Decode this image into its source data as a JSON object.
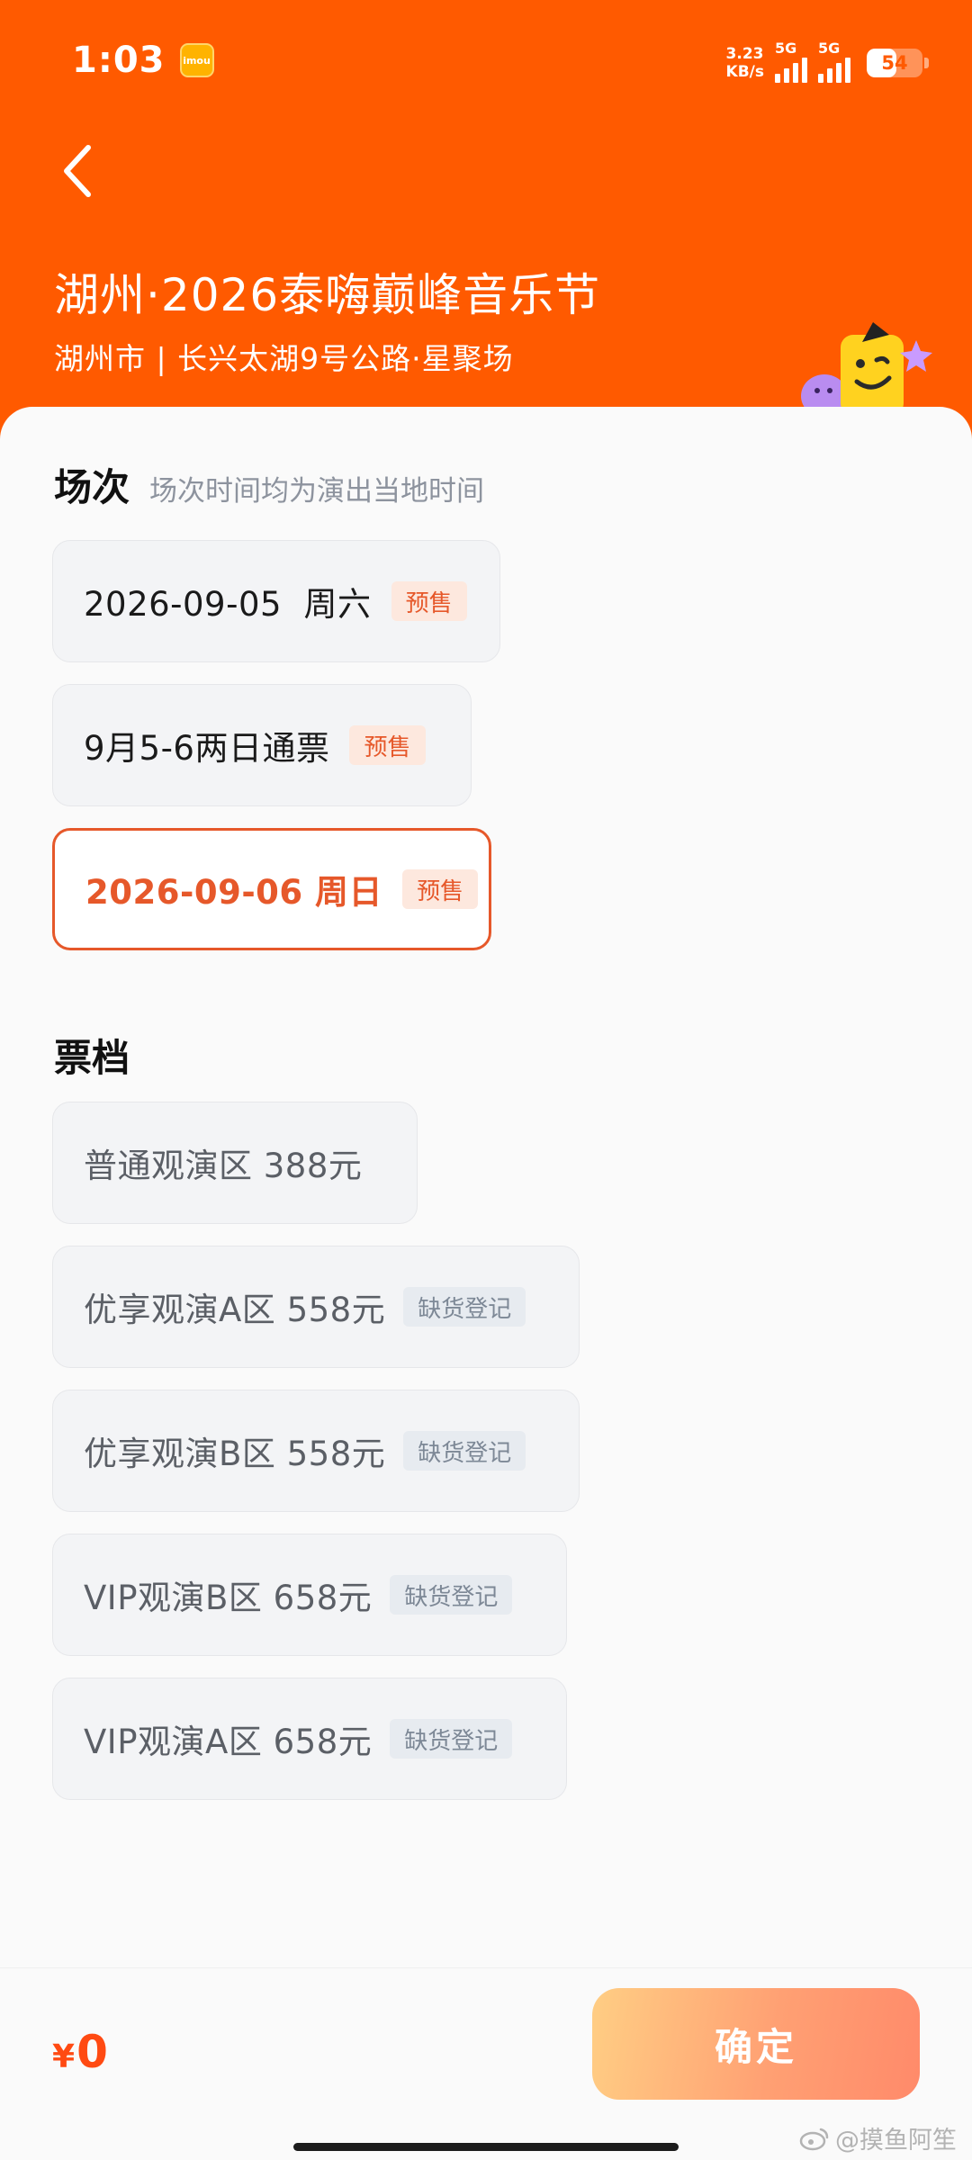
{
  "status_bar": {
    "time": "1:03",
    "app_badge": "imou",
    "net_speed_value": "3.23",
    "net_speed_unit": "KB/s",
    "sim1_label": "5G",
    "sim2_label": "5G",
    "battery": "54",
    "battery_level": 0.54
  },
  "header": {
    "title": "湖州·2026泰嗨巅峰音乐节",
    "venue": "湖州市 | 长兴太湖9号公路·星聚场"
  },
  "sessions": {
    "title": "场次",
    "subtitle": "场次时间均为演出当地时间",
    "items": [
      {
        "label": "2026-09-05  周六",
        "tag": "预售",
        "selected": false
      },
      {
        "label": "9月5-6两日通票",
        "tag": "预售",
        "selected": false
      },
      {
        "label": "2026-09-06 周日",
        "tag": "预售",
        "selected": true
      }
    ]
  },
  "tiers": {
    "title": "票档",
    "items": [
      {
        "label": "普通观演区 388元",
        "tag": ""
      },
      {
        "label": "优享观演A区 558元",
        "tag": "缺货登记"
      },
      {
        "label": "优享观演B区 558元",
        "tag": "缺货登记"
      },
      {
        "label": "VIP观演B区 658元",
        "tag": "缺货登记"
      },
      {
        "label": "VIP观演A区 658元",
        "tag": "缺货登记"
      }
    ]
  },
  "footer": {
    "currency": "¥",
    "total": "0",
    "confirm_label": "确定"
  },
  "watermark": "@摸鱼阿笙",
  "colors": {
    "brand_orange": "#ff5a00",
    "accent": "#e6582a",
    "price": "#ff4a12"
  }
}
